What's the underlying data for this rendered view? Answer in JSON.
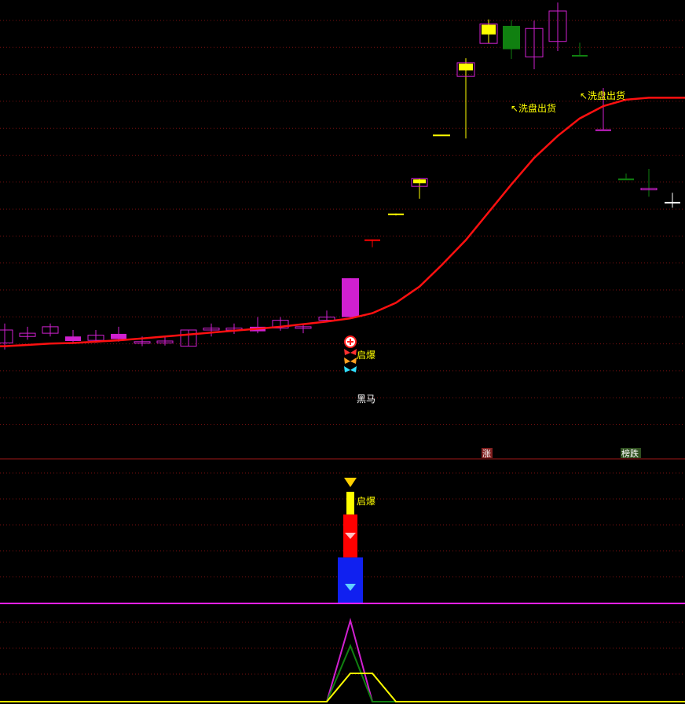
{
  "colors": {
    "background": "#000000",
    "grid": "#7a1010",
    "divider": "#a01818",
    "up_candle": "#d020d0",
    "down_candle_green": "#108010",
    "yellow_body": "#ffff00",
    "ma_line": "#ff1010",
    "text_yellow": "#ffff00",
    "text_white": "#ffffff",
    "magenta": "#ff20ff",
    "green": "#20d040",
    "blue": "#1020f0",
    "red": "#ff0000",
    "cyan": "#30e0ff"
  },
  "labels": {
    "qibao_main": "启爆",
    "heima": "黑马",
    "xipan_1": "↖洗盘出货",
    "xipan_2": "↖洗盘出货",
    "zhang": "涨",
    "bangdie": "榜跌",
    "qibao_sub": "启爆"
  },
  "icons": {
    "plus_circle": "plus-circle-icon",
    "butterfly_red": "butterfly-icon",
    "butterfly_orange": "butterfly-icon",
    "butterfly_cyan": "butterfly-icon",
    "gem_red": "diamond-icon",
    "gem_blue": "diamond-icon",
    "arrow_down": "arrow-down-icon"
  },
  "chart_data": [
    {
      "type": "candlestick",
      "panel": "main",
      "x": [
        1,
        2,
        3,
        4,
        5,
        6,
        7,
        8,
        9,
        10,
        11,
        12,
        13,
        14,
        15,
        16,
        17,
        18,
        19,
        20,
        21,
        22,
        23,
        24,
        25,
        26,
        27,
        28,
        29,
        30
      ],
      "candles": [
        {
          "o": 55,
          "c": 57,
          "h": 58,
          "l": 54,
          "color": "magenta",
          "hollow": true
        },
        {
          "o": 56,
          "c": 56.5,
          "h": 57.5,
          "l": 55.5,
          "color": "magenta",
          "hollow": true
        },
        {
          "o": 56.5,
          "c": 57.5,
          "h": 58,
          "l": 56,
          "color": "magenta",
          "hollow": true
        },
        {
          "o": 56,
          "c": 55.3,
          "h": 57,
          "l": 55,
          "color": "magenta",
          "hollow": false
        },
        {
          "o": 55.4,
          "c": 56.2,
          "h": 57,
          "l": 55,
          "color": "magenta",
          "hollow": true
        },
        {
          "o": 56.4,
          "c": 55.6,
          "h": 57.5,
          "l": 55.2,
          "color": "magenta",
          "hollow": false
        },
        {
          "o": 55,
          "c": 55.2,
          "h": 56,
          "l": 54.5,
          "color": "magenta",
          "hollow": true
        },
        {
          "o": 55,
          "c": 55.3,
          "h": 56,
          "l": 54.6,
          "color": "magenta",
          "hollow": true
        },
        {
          "o": 54.5,
          "c": 57,
          "h": 57,
          "l": 54.5,
          "color": "magenta",
          "hollow": true
        },
        {
          "o": 57,
          "c": 57.3,
          "h": 58,
          "l": 56,
          "color": "magenta",
          "hollow": true
        },
        {
          "o": 57,
          "c": 57.3,
          "h": 58,
          "l": 56.4,
          "color": "magenta",
          "hollow": true
        },
        {
          "o": 57.5,
          "c": 56.8,
          "h": 59,
          "l": 56.5,
          "color": "magenta",
          "hollow": false
        },
        {
          "o": 57.3,
          "c": 58.5,
          "h": 59,
          "l": 56.9,
          "color": "magenta",
          "hollow": true
        },
        {
          "o": 57.5,
          "c": 57.3,
          "h": 58,
          "l": 56.5,
          "color": "magenta",
          "hollow": true
        },
        {
          "o": 58.5,
          "c": 59,
          "h": 60,
          "l": 58.5,
          "color": "magenta",
          "hollow": true
        },
        {
          "o": 59,
          "c": 65,
          "h": 65,
          "l": 58.7,
          "color": "magenta",
          "hollow": false
        },
        {
          "o": 71,
          "c": 71,
          "h": 71,
          "l": 69.8,
          "color": "red",
          "hollow": false
        },
        {
          "o": 75,
          "c": 75,
          "h": 75,
          "l": 74.7,
          "color": "yellow",
          "hollow": false
        },
        {
          "o": 79.2,
          "c": 80.4,
          "h": 80.4,
          "l": 77.3,
          "color": "yellow",
          "hollow": true
        },
        {
          "o": 87.2,
          "c": 87.2,
          "h": 87.2,
          "l": 87.2,
          "color": "yellow",
          "hollow": false
        },
        {
          "o": 96.2,
          "c": 98.3,
          "h": 99,
          "l": 86.6,
          "color": "yellow",
          "hollow": true
        },
        {
          "o": 101.3,
          "c": 104.3,
          "h": 105,
          "l": 101.3,
          "color": "yellow",
          "hollow": true
        },
        {
          "o": 104,
          "c": 100.4,
          "h": 104.9,
          "l": 98.9,
          "color": "green",
          "hollow": false
        },
        {
          "o": 99.2,
          "c": 103.6,
          "h": 104.8,
          "l": 97.3,
          "color": "magenta",
          "hollow": true
        },
        {
          "o": 101.6,
          "c": 106.3,
          "h": 107.6,
          "l": 100.1,
          "color": "magenta",
          "hollow": true
        },
        {
          "o": 99.5,
          "c": 99.5,
          "h": 101.4,
          "l": 99.5,
          "color": "green",
          "hollow": false
        },
        {
          "o": 88,
          "c": 88,
          "h": 94.4,
          "l": 88,
          "color": "magenta",
          "hollow": false
        },
        {
          "o": 80.4,
          "c": 80.4,
          "h": 81.2,
          "l": 80.4,
          "color": "green",
          "hollow": false
        },
        {
          "o": 78.9,
          "c": 78.9,
          "h": 81.9,
          "l": 77.6,
          "color": "green",
          "hollow": true
        },
        {
          "o": 76.8,
          "c": 76.8,
          "h": 78.2,
          "l": 75.9,
          "color": "white",
          "hollow": false
        }
      ],
      "ma": [
        54.5,
        54.7,
        54.9,
        55.0,
        55.2,
        55.4,
        55.7,
        56.0,
        56.3,
        56.6,
        56.9,
        57.2,
        57.5,
        57.9,
        58.3,
        58.8,
        59.6,
        61.2,
        63.7,
        67.0,
        70.9,
        75.2,
        79.5,
        83.6,
        87.0,
        89.7,
        91.6,
        92.6,
        92.9,
        92.9
      ],
      "ylim": [
        40,
        108
      ]
    },
    {
      "type": "bar",
      "panel": "signal",
      "segments": [
        {
          "color": "blue",
          "from": 0,
          "to": 20
        },
        {
          "color": "red",
          "from": 20,
          "to": 39
        },
        {
          "color": "yellow",
          "from": 39,
          "to": 49
        }
      ],
      "x_index": 16,
      "ylim": [
        0,
        58
      ]
    },
    {
      "type": "line",
      "panel": "oscillator",
      "series": [
        {
          "color": "magenta",
          "values": [
            0,
            0,
            0,
            0,
            0,
            0,
            0,
            0,
            0,
            0,
            0,
            0,
            0,
            0,
            0,
            100,
            0,
            0,
            0,
            0,
            0,
            0,
            0,
            0,
            0,
            0,
            0,
            0,
            0,
            0
          ]
        },
        {
          "color": "green",
          "values": [
            0,
            0,
            0,
            0,
            0,
            0,
            0,
            0,
            0,
            0,
            0,
            0,
            0,
            0,
            0,
            69,
            0,
            0,
            0,
            0,
            0,
            0,
            0,
            0,
            0,
            0,
            0,
            0,
            0,
            0
          ]
        },
        {
          "color": "yellow",
          "values": [
            0,
            0,
            0,
            0,
            0,
            0,
            0,
            0,
            0,
            0,
            0,
            0,
            0,
            0,
            0,
            35,
            35,
            0,
            0,
            0,
            0,
            0,
            0,
            0,
            0,
            0,
            0,
            0,
            0,
            0
          ]
        }
      ],
      "ylim": [
        0,
        100
      ]
    }
  ]
}
